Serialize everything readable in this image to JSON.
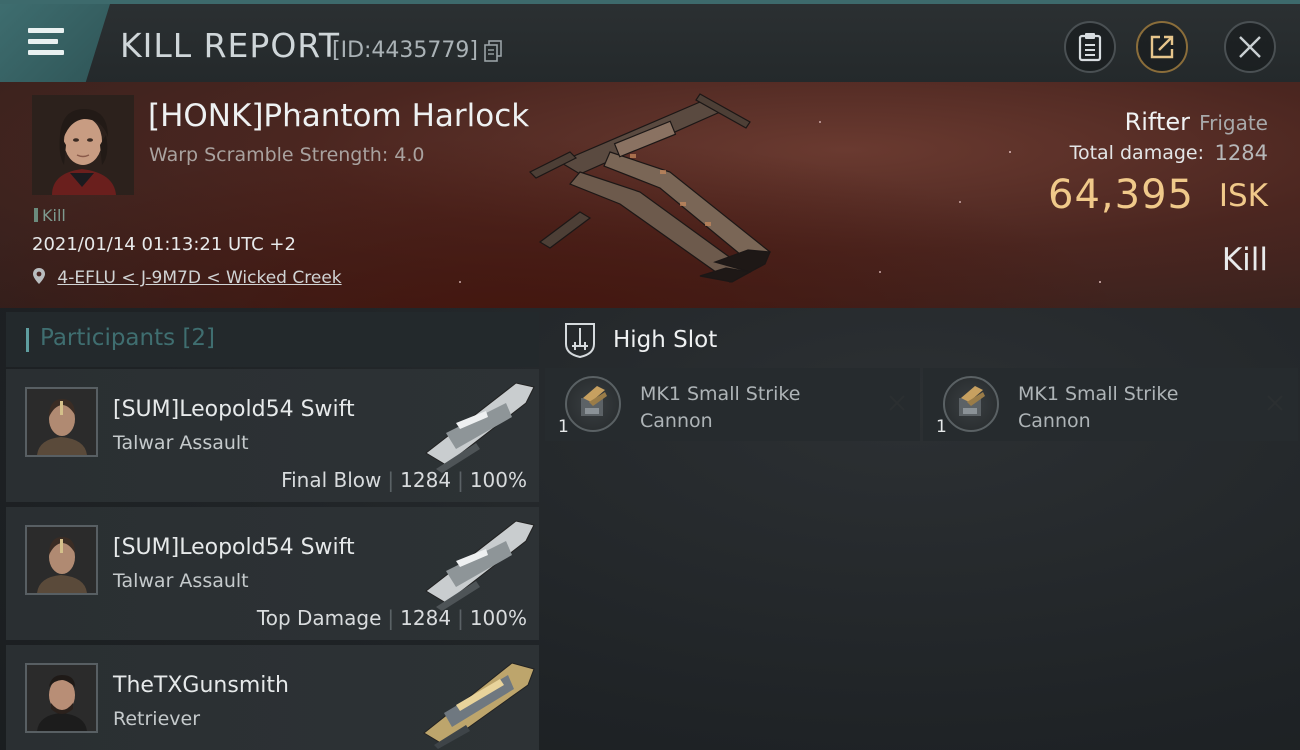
{
  "header": {
    "title": "KILL REPORT",
    "report_id": "[ID:4435779]"
  },
  "victim": {
    "name": "[HONK]Phantom Harlock",
    "scramble": "Warp Scramble Strength: 4.0",
    "tag": "Kill",
    "datetime": "2021/01/14 01:13:21 UTC +2",
    "location": "4-EFLU < J-9M7D < Wicked Creek",
    "ship_name": "Rifter",
    "ship_class": "Frigate",
    "total_damage_label": "Total damage:",
    "total_damage_value": "1284",
    "isk_value": "64,395",
    "isk_unit": "ISK",
    "result": "Kill"
  },
  "participants": {
    "label": "Participants",
    "count": "[2]",
    "items": [
      {
        "name": "[SUM]Leopold54 Swift",
        "ship": "Talwar Assault",
        "role": "Final Blow",
        "damage": "1284",
        "percent": "100%"
      },
      {
        "name": "[SUM]Leopold54 Swift",
        "ship": "Talwar Assault",
        "role": "Top Damage",
        "damage": "1284",
        "percent": "100%"
      },
      {
        "name": "TheTXGunsmith",
        "ship": "Retriever"
      }
    ]
  },
  "slots": {
    "title": "High Slot",
    "modules": [
      {
        "qty": "1",
        "line1": "MK1 Small Strike",
        "line2": "Cannon"
      },
      {
        "qty": "1",
        "line1": "MK1 Small Strike",
        "line2": "Cannon"
      }
    ]
  },
  "colors": {
    "accent": "#3e6d6f",
    "isk": "#f0c98a",
    "participants_label": "#3f6e70"
  }
}
